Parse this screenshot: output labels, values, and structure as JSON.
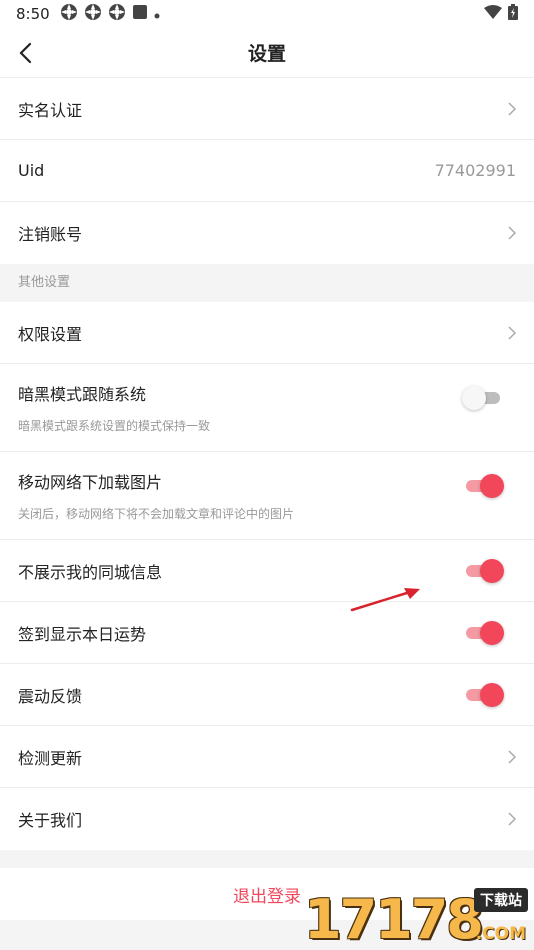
{
  "status_bar": {
    "time": "8:50",
    "notification_icons": [
      "app-icon",
      "app-icon",
      "app-icon",
      "square-icon",
      "dot-icon"
    ],
    "right_icons": [
      "wifi-icon",
      "battery-icon"
    ]
  },
  "header": {
    "title": "设置",
    "back_icon": "chevron-left-icon"
  },
  "account_section": {
    "items": [
      {
        "label": "实名认证",
        "type": "link"
      },
      {
        "label": "Uid",
        "value": "77402991",
        "type": "value"
      },
      {
        "label": "注销账号",
        "type": "link"
      }
    ]
  },
  "other_section": {
    "header": "其他设置",
    "items": [
      {
        "label": "权限设置",
        "type": "link"
      },
      {
        "label": "暗黑模式跟随系统",
        "desc": "暗黑模式跟系统设置的模式保持一致",
        "type": "toggle",
        "on": false
      },
      {
        "label": "移动网络下加载图片",
        "desc": "关闭后，移动网络下将不会加载文章和评论中的图片",
        "type": "toggle",
        "on": true
      },
      {
        "label": "不展示我的同城信息",
        "type": "toggle",
        "on": true
      },
      {
        "label": "签到显示本日运势",
        "type": "toggle",
        "on": true
      },
      {
        "label": "震动反馈",
        "type": "toggle",
        "on": true
      },
      {
        "label": "检测更新",
        "type": "link"
      },
      {
        "label": "关于我们",
        "type": "link"
      }
    ]
  },
  "logout": {
    "label": "退出登录"
  },
  "watermark": {
    "digits": "17178",
    "badge": "下载站",
    "domain": ".COM"
  },
  "colors": {
    "accent": "#f2475b",
    "toggle_track_on": "#f59aa3",
    "toggle_off": "#bdbdbd",
    "secondary_text": "#999999"
  }
}
